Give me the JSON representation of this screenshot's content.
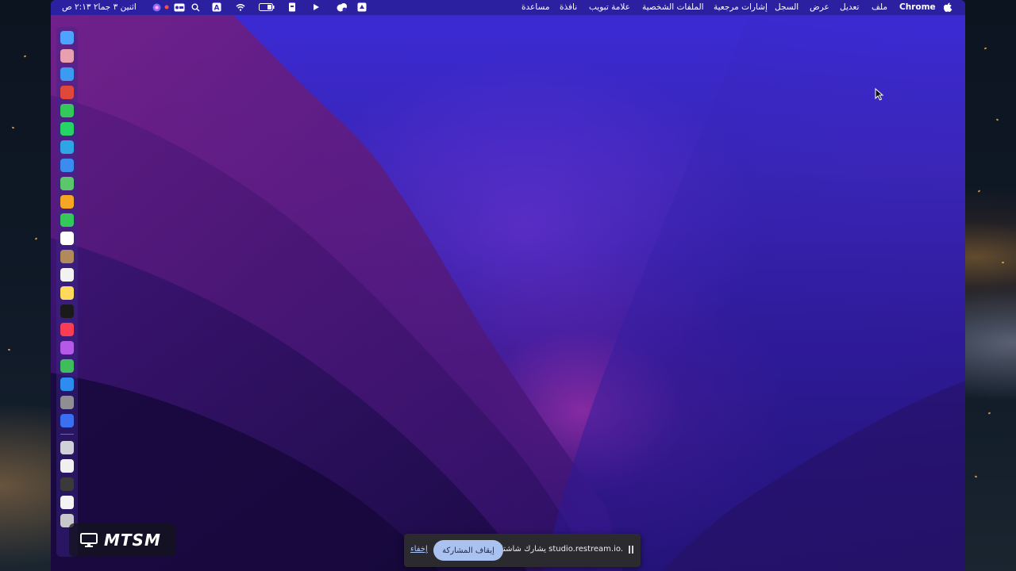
{
  "menubar": {
    "apple_icon": "apple-icon",
    "app_name": "Chrome",
    "items": [
      "ملف",
      "تعديل",
      "عرض",
      "السجل",
      "إشارات مرجعية",
      "الملفات الشخصية",
      "علامة تبويب",
      "نافذة",
      "مساعدة"
    ],
    "clock": "اثنين ٣ جما٢ ٢:١٣ ص",
    "status_icons": [
      "app-icon",
      "play-icon",
      "bookmark-icon",
      "battery-icon",
      "text-input-icon",
      "wifi-icon",
      "search-icon",
      "control-center-icon",
      "siri-icon"
    ]
  },
  "dock": {
    "apps": [
      {
        "name": "finder",
        "color": "#4da3ff"
      },
      {
        "name": "launchpad",
        "color": "#e8a0b0"
      },
      {
        "name": "safari",
        "color": "#3a9bf0"
      },
      {
        "name": "chrome",
        "color": "#e0483a"
      },
      {
        "name": "messages",
        "color": "#34c759"
      },
      {
        "name": "whatsapp",
        "color": "#25d366"
      },
      {
        "name": "telegram",
        "color": "#2ea6e6"
      },
      {
        "name": "mail",
        "color": "#3c8cf0"
      },
      {
        "name": "maps",
        "color": "#5ac86a"
      },
      {
        "name": "photos",
        "color": "#f5a623"
      },
      {
        "name": "facetime",
        "color": "#34c759"
      },
      {
        "name": "calendar",
        "color": "#ffffff"
      },
      {
        "name": "contacts",
        "color": "#b08a5a"
      },
      {
        "name": "reminders",
        "color": "#f2f2f2"
      },
      {
        "name": "notes",
        "color": "#ffd95a"
      },
      {
        "name": "apple-tv",
        "color": "#1a1a1a"
      },
      {
        "name": "music",
        "color": "#fa3c55"
      },
      {
        "name": "podcasts",
        "color": "#b45ae6"
      },
      {
        "name": "numbers",
        "color": "#3fbd5c"
      },
      {
        "name": "app-store",
        "color": "#2d8cf0"
      },
      {
        "name": "system-preferences",
        "color": "#8e8e93"
      },
      {
        "name": "xcode-controller",
        "color": "#3a6ff0"
      }
    ],
    "extras": [
      {
        "name": "screen-sharing",
        "color": "#d0d0d8"
      },
      {
        "name": "preview",
        "color": "#f0f0f0"
      },
      {
        "name": "stocks",
        "color": "#3a3a3a"
      },
      {
        "name": "document",
        "color": "#f4f4f4"
      },
      {
        "name": "trash",
        "color": "#c8c8cc"
      }
    ]
  },
  "sharebar": {
    "message": "يشارك شاشتك studio.restream.io.",
    "stop_label": "إيقاف المشاركة",
    "hide_label": "إخفاء"
  },
  "watermark": {
    "text": "MTSM"
  }
}
